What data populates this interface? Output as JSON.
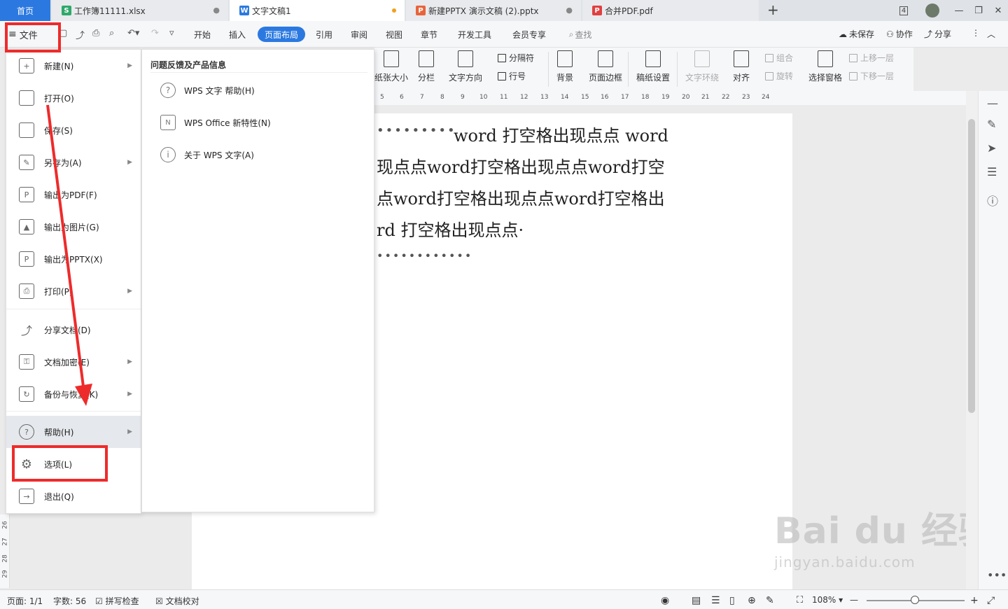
{
  "tabs": {
    "home": "首页",
    "items": [
      {
        "icon": "S",
        "color": "#2fa86b",
        "label": "工作簿11111.xlsx"
      },
      {
        "icon": "W",
        "color": "#2b79e0",
        "label": "文字文稿1"
      },
      {
        "icon": "P",
        "color": "#e8643a",
        "label": "新建PPTX 演示文稿 (2).pptx"
      },
      {
        "icon": "P",
        "color": "#e04040",
        "label": "合并PDF.pdf"
      }
    ],
    "count_badge": "4"
  },
  "toolbar": {
    "file_label": "文件",
    "menus": [
      "开始",
      "插入",
      "页面布局",
      "引用",
      "审阅",
      "视图",
      "章节",
      "开发工具",
      "会员专享"
    ],
    "active_menu": "页面布局",
    "search": "查找",
    "unsaved": "未保存",
    "collab": "协作",
    "share": "分享"
  },
  "ribbon": {
    "paper_size": "纸张大小",
    "columns": "分栏",
    "text_direction": "文字方向",
    "separator": "分隔符",
    "line_number": "行号",
    "background": "背景",
    "page_border": "页面边框",
    "grid_paper": "稿纸设置",
    "text_wrap": "文字环绕",
    "align": "对齐",
    "group": "组合",
    "rotate": "旋转",
    "selection_pane": "选择窗格",
    "bring_forward": "上移一层",
    "send_backward": "下移一层"
  },
  "ruler": [
    "5",
    "6",
    "7",
    "8",
    "9",
    "10",
    "11",
    "12",
    "13",
    "14",
    "15",
    "16",
    "17",
    "18",
    "19",
    "20",
    "21",
    "22",
    "23",
    "24"
  ],
  "vruler": [
    "26",
    "27",
    "28",
    "29"
  ],
  "document": {
    "line1_dots": "•••••••••",
    "line1": "word 打空格出现点点 word",
    "line2": "现点点word打空格出现点点word打空",
    "line3": "点word打空格出现点点word打空格出",
    "line4": "rd 打空格出现点点·",
    "line5_dots": "••••••••••••"
  },
  "file_menu": [
    {
      "label": "新建(N)",
      "icon": "new-icon",
      "arrow": true
    },
    {
      "label": "打开(O)",
      "icon": "open-folder-icon",
      "arrow": false
    },
    {
      "label": "保存(S)",
      "icon": "save-icon",
      "arrow": false
    },
    {
      "label": "另存为(A)",
      "icon": "save-as-icon",
      "arrow": true
    },
    {
      "label": "输出为PDF(F)",
      "icon": "export-pdf-icon",
      "arrow": false
    },
    {
      "label": "输出为图片(G)",
      "icon": "export-image-icon",
      "arrow": false
    },
    {
      "label": "输出为PPTX(X)",
      "icon": "export-pptx-icon",
      "arrow": false
    },
    {
      "label": "打印(P)",
      "icon": "print-icon",
      "arrow": true
    },
    {
      "label": "分享文档(D)",
      "icon": "share-icon",
      "arrow": false
    },
    {
      "label": "文档加密(E)",
      "icon": "encrypt-icon",
      "arrow": true
    },
    {
      "label": "备份与恢复(K)",
      "icon": "backup-icon",
      "arrow": true
    },
    {
      "label": "帮助(H)",
      "icon": "help-icon",
      "arrow": true
    },
    {
      "label": "选项(L)",
      "icon": "gear-icon",
      "arrow": false
    },
    {
      "label": "退出(Q)",
      "icon": "exit-icon",
      "arrow": false
    }
  ],
  "submenu": {
    "title": "问题反馈及产品信息",
    "items": [
      {
        "label": "WPS 文字 帮助(H)",
        "icon": "question-icon"
      },
      {
        "label": "WPS Office 新特性(N)",
        "icon": "new-feature-icon"
      },
      {
        "label": "关于 WPS 文字(A)",
        "icon": "info-icon"
      }
    ]
  },
  "statusbar": {
    "page": "页面: 1/1",
    "words": "字数: 56",
    "spell": "拼写检查",
    "proof": "文档校对",
    "zoom": "108%"
  },
  "watermark": {
    "brand": "Bai du 经验",
    "url": "jingyan.baidu.com"
  },
  "colors": {
    "accent": "#2b79e0",
    "annotation_red": "#ee2b2b"
  }
}
